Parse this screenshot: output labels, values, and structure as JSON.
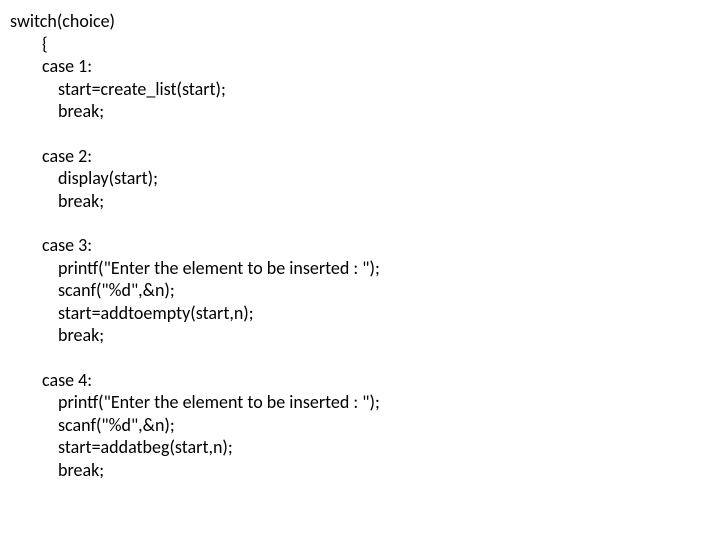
{
  "code": {
    "l0": "switch(choice)",
    "l1": "{",
    "l2": "case 1:",
    "l3": "start=create_list(start);",
    "l4": "break;",
    "l5": "case 2:",
    "l6": "display(start);",
    "l7": "break;",
    "l8": "case 3:",
    "l9": "printf(\"Enter the element to be inserted : \");",
    "l10": "scanf(\"%d\",&n);",
    "l11": "start=addtoempty(start,n);",
    "l12": "break;",
    "l13": "case 4:",
    "l14": "printf(\"Enter the element to be inserted : \");",
    "l15": "scanf(\"%d\",&n);",
    "l16": "start=addatbeg(start,n);",
    "l17": "break;"
  }
}
